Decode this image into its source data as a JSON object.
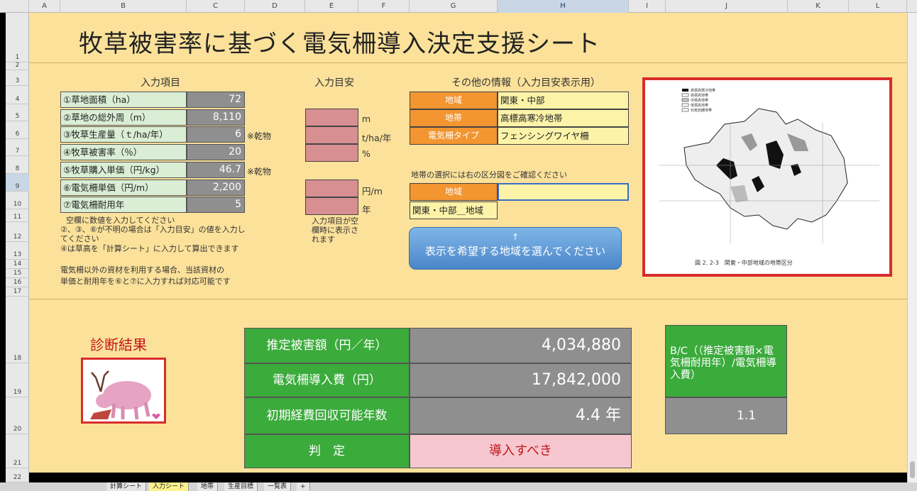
{
  "columns": [
    "A",
    "B",
    "C",
    "D",
    "E",
    "F",
    "G",
    "H",
    "I",
    "J",
    "K",
    "L"
  ],
  "rows": [
    "1",
    "2",
    "3",
    "4",
    "5",
    "6",
    "7",
    "8",
    "9",
    "10",
    "11",
    "12",
    "13",
    "14",
    "15",
    "16",
    "17",
    "18",
    "19",
    "20",
    "21",
    "22"
  ],
  "sheet": {
    "title": "牧草被害率に基づく電気柵導入決定支援シート",
    "input_header": "入力項目",
    "guide_header": "入力目安",
    "other_header": "その他の情報（入力目安表示用）",
    "inputs": [
      {
        "label": "①草地面積（ha）",
        "value": "72",
        "note": ""
      },
      {
        "label": "②草地の総外周（m）",
        "value": "8,110",
        "note": ""
      },
      {
        "label": "③牧草生産量（ｔ/ha/年）",
        "value": "6",
        "note": "※乾物"
      },
      {
        "label": "④牧草被害率（％）",
        "value": "20",
        "note": ""
      },
      {
        "label": "⑤牧草購入単価（円/kg）",
        "value": "46.7",
        "note": "※乾物"
      },
      {
        "label": "⑥電気柵単価（円/m）",
        "value": "2,200",
        "note": ""
      },
      {
        "label": "⑦電気柵耐用年",
        "value": "5",
        "note": ""
      }
    ],
    "guide_units": [
      "m",
      "t/ha/年",
      "%",
      "円/m",
      "年"
    ],
    "guide_note": "入力項目が空欄時に表示されます",
    "notes": [
      "空欄に数値を入力してください",
      "②、③、⑥が不明の場合は「入力目安」の値を入力してください",
      "④は草高を「計算シート」に入力して算出できます",
      "電気柵以外の資材を利用する場合、当該資材の",
      "単価と耐用年を⑥と⑦に入力すれば対応可能です"
    ],
    "other_info": [
      {
        "label": "地域",
        "value": "関東・中部"
      },
      {
        "label": "地帯",
        "value": "高標高寒冷地帯"
      },
      {
        "label": "電気柵タイプ",
        "value": "フェンシングワイヤ柵"
      }
    ],
    "zone_note": "地帯の選択には右の区分図をご確認ください",
    "region_label": "地域",
    "region_input": "",
    "region_result": "関東・中部＿地域",
    "button_arrow": "↑",
    "button_text": "表示を希望する地域を選んでください",
    "map_caption": "図 2. 2-3　関東・中部地域の地帯区分",
    "map_legend": [
      "高標高寒冷地帯",
      "高標高地帯",
      "中標高地帯",
      "低標高地帯",
      "石炭岩醸地帯"
    ],
    "diagnosis_label": "診断結果",
    "results": [
      {
        "label": "推定被害額（円／年）",
        "value": "4,034,880"
      },
      {
        "label": "電気柵導入費（円）",
        "value": "17,842,000"
      },
      {
        "label": "初期経費回収可能年数",
        "value": "4.4 年"
      }
    ],
    "judge_label": "判　定",
    "judge_value": "導入すべき",
    "bc_label": "B/C（（推定被害額×電気柵耐用年）/電気柵導入費）",
    "bc_value": "1.1"
  },
  "tabs": [
    "計算シート",
    "入力シート",
    "地帯",
    "生産目標",
    "一覧表",
    "+"
  ],
  "active_tab": "入力シート",
  "colors": {
    "sheet_bg": "#fbe19a",
    "green_label": "#d9eed4",
    "result_green": "#3bab3c",
    "value_gray": "#8f8f8f",
    "guide_pink": "#d88f92",
    "orange": "#f39530",
    "alert_red": "#d82c2c"
  }
}
